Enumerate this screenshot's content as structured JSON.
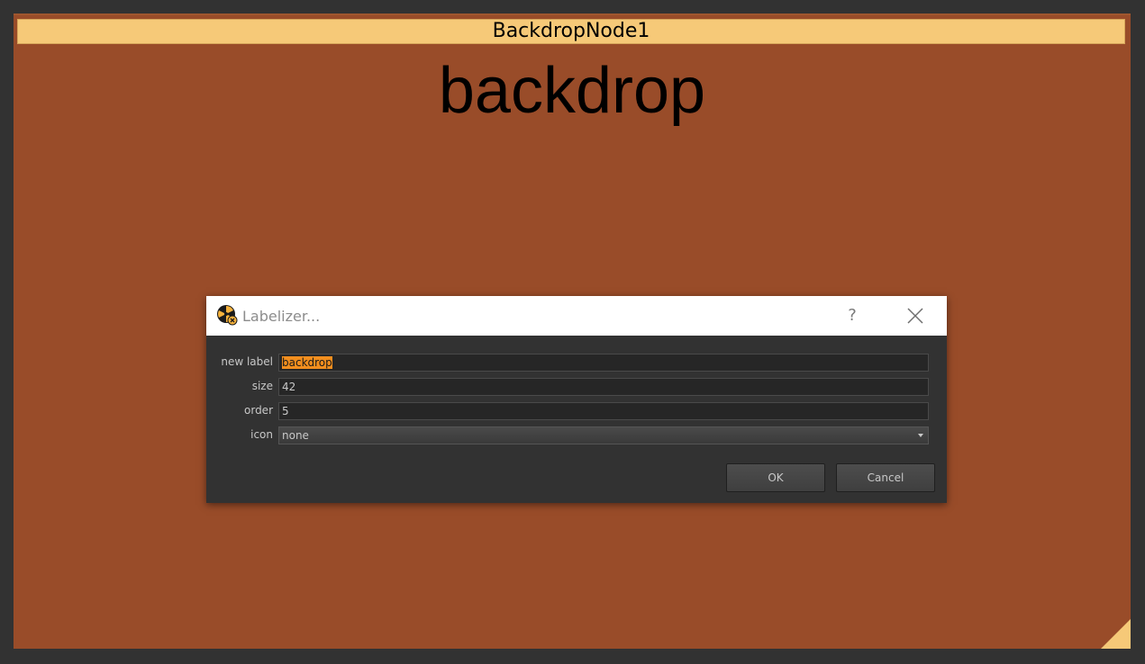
{
  "backdrop": {
    "node_name": "BackdropNode1",
    "label": "backdrop",
    "color": "#994c29",
    "title_color": "#f6c978"
  },
  "dialog": {
    "title": "Labelizer...",
    "help_label": "?",
    "icons": {
      "app": "nuke-app-icon",
      "help": "help-icon",
      "close": "close-icon"
    },
    "fields": {
      "new_label": {
        "label": "new label",
        "value": "backdrop"
      },
      "size": {
        "label": "size",
        "value": "42"
      },
      "order": {
        "label": "order",
        "value": "5"
      },
      "icon": {
        "label": "icon",
        "value": "none"
      }
    },
    "buttons": {
      "ok": "OK",
      "cancel": "Cancel"
    },
    "selection_color": "#f28e1e"
  }
}
